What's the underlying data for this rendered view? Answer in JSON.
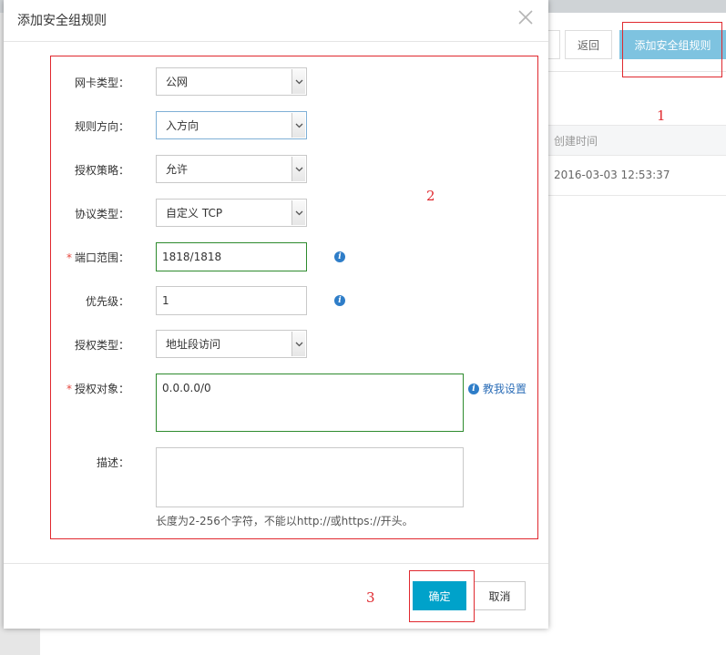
{
  "background": {
    "back_button": "返回",
    "add_button": "添加安全组规则",
    "table_header_created": "创建时间",
    "table_cell_created": "2016-03-03 12:53:37"
  },
  "dialog": {
    "title": "添加安全组规则",
    "fields": {
      "nic_type": {
        "label": "网卡类型：",
        "value": "公网"
      },
      "direction": {
        "label": "规则方向：",
        "value": "入方向"
      },
      "policy": {
        "label": "授权策略：",
        "value": "允许"
      },
      "protocol": {
        "label": "协议类型：",
        "value": "自定义 TCP"
      },
      "port_range": {
        "label": "端口范围：",
        "value": "1818/1818",
        "required_mark": "*"
      },
      "priority": {
        "label": "优先级：",
        "value": "1"
      },
      "auth_type": {
        "label": "授权类型：",
        "value": "地址段访问"
      },
      "auth_object": {
        "label": "授权对象：",
        "value": "0.0.0.0/0",
        "required_mark": "*",
        "help_link": "教我设置"
      },
      "description": {
        "label": "描述：",
        "value": "",
        "hint": "长度为2-256个字符，不能以http://或https://开头。"
      }
    },
    "ok_button": "确定",
    "cancel_button": "取消"
  },
  "annotations": {
    "n1": "1",
    "n2": "2",
    "n3": "3"
  },
  "colors": {
    "primary_button": "#00a2ca",
    "background_add_button": "#7ec3e0",
    "annotation_red": "#e0282e",
    "valid_border": "#2e8b2e",
    "info_icon": "#2e7dc8",
    "link": "#2e6fb8"
  }
}
